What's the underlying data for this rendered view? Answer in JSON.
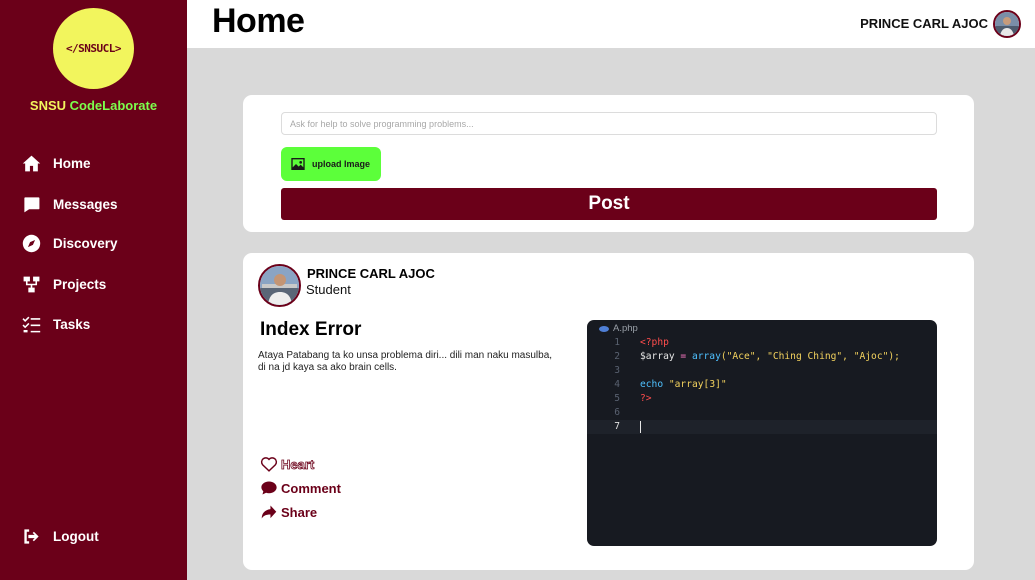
{
  "brand": {
    "logo_text": "</SNSUCL>",
    "name_part1": "SNSU ",
    "name_part2": "CodeLaborate"
  },
  "nav": {
    "items": [
      {
        "label": "Home",
        "icon": "home-icon"
      },
      {
        "label": "Messages",
        "icon": "message-icon"
      },
      {
        "label": "Discovery",
        "icon": "compass-icon"
      },
      {
        "label": "Projects",
        "icon": "diagram-icon"
      },
      {
        "label": "Tasks",
        "icon": "list-check-icon"
      }
    ],
    "logout_label": "Logout"
  },
  "header": {
    "title": "Home",
    "user_name": "PRINCE CARL AJOC"
  },
  "composer": {
    "placeholder": "Ask for help to solve programming problems...",
    "upload_label": "upload Image",
    "post_label": "Post"
  },
  "post": {
    "author_name": "PRINCE CARL AJOC",
    "author_role": "Student",
    "title": "Index Error",
    "body": "Ataya Patabang ta ko unsa problema diri... dili man naku masulba, di na jd kaya sa ako brain cells.",
    "actions": {
      "heart": "Heart",
      "comment": "Comment",
      "share": "Share"
    },
    "code": {
      "file_name": "A.php",
      "line_numbers": [
        "1",
        "2",
        "3",
        "4",
        "5",
        "6",
        "7"
      ],
      "line1": "<?php",
      "line2_var": "$array",
      "line2_op": " = ",
      "line2_fn": "array",
      "line2_args": "(\"Ace\", \"Ching Ching\", \"Ajoc\");",
      "line4_kw": "echo",
      "line4_str": " \"array[3]\"",
      "line5": "?>"
    }
  },
  "colors": {
    "primary": "#6b0019",
    "logo_yellow": "#f2f55d",
    "accent_green": "#5cff3a",
    "code_bg": "#171a21",
    "page_bg": "#d9d9d9"
  }
}
